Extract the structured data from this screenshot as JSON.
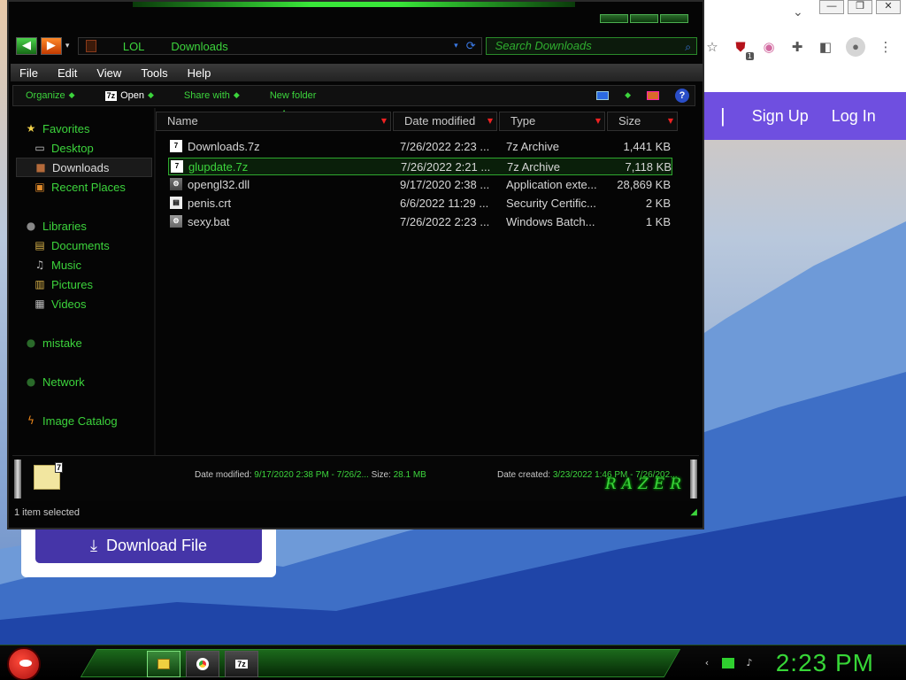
{
  "browser": {
    "chevron_icon": "chevron-down",
    "extensions": [
      "star-icon",
      "shield-extension-icon",
      "extension-circle-icon",
      "puzzle-icon",
      "side-panel-icon",
      "profile-avatar",
      "kebab-menu-icon"
    ],
    "extension_badge": "1"
  },
  "site": {
    "nav_sep": "|",
    "signup_label": "Sign Up",
    "login_label": "Log In",
    "download_label": "Download File"
  },
  "explorer": {
    "address": {
      "crumbs": [
        "LOL",
        "Downloads"
      ]
    },
    "search_placeholder": "Search Downloads",
    "menu": [
      "File",
      "Edit",
      "View",
      "Tools",
      "Help"
    ],
    "commands": {
      "organize": "Organize",
      "open": "Open",
      "share": "Share with",
      "new_folder": "New folder"
    },
    "sidebar": {
      "favorites": "Favorites",
      "desktop": "Desktop",
      "downloads": "Downloads",
      "recent": "Recent Places",
      "libraries": "Libraries",
      "documents": "Documents",
      "music": "Music",
      "pictures": "Pictures",
      "videos": "Videos",
      "mistake": "mistake",
      "network": "Network",
      "image_catalog": "Image Catalog"
    },
    "columns": {
      "name": "Name",
      "date": "Date modified",
      "type": "Type",
      "size": "Size"
    },
    "files": [
      {
        "name": "Downloads.7z",
        "date": "7/26/2022 2:23 ...",
        "type": "7z Archive",
        "size": "1,441 KB"
      },
      {
        "name": "glupdate.7z",
        "date": "7/26/2022 2:21 ...",
        "type": "7z Archive",
        "size": "7,118 KB"
      },
      {
        "name": "opengl32.dll",
        "date": "9/17/2020 2:38 ...",
        "type": "Application exte...",
        "size": "28,869 KB"
      },
      {
        "name": "penis.crt",
        "date": "6/6/2022 11:29 ...",
        "type": "Security Certific...",
        "size": "2 KB"
      },
      {
        "name": "sexy.bat",
        "date": "7/26/2022 2:23 ...",
        "type": "Windows Batch...",
        "size": "1 KB"
      }
    ],
    "details": {
      "date_label": "Date modified:",
      "date_value": "9/17/2020 2:38 PM - 7/26/2...",
      "size_label": "Size:",
      "size_value": "28.1 MB",
      "created_label": "Date created:",
      "created_value": "3/23/2022 1:46 PM - 7/26/202...",
      "brand": "RAZER"
    },
    "status": "1 item selected"
  },
  "taskbar": {
    "clock": "2:23 PM",
    "seven_zip_label": "7z"
  }
}
